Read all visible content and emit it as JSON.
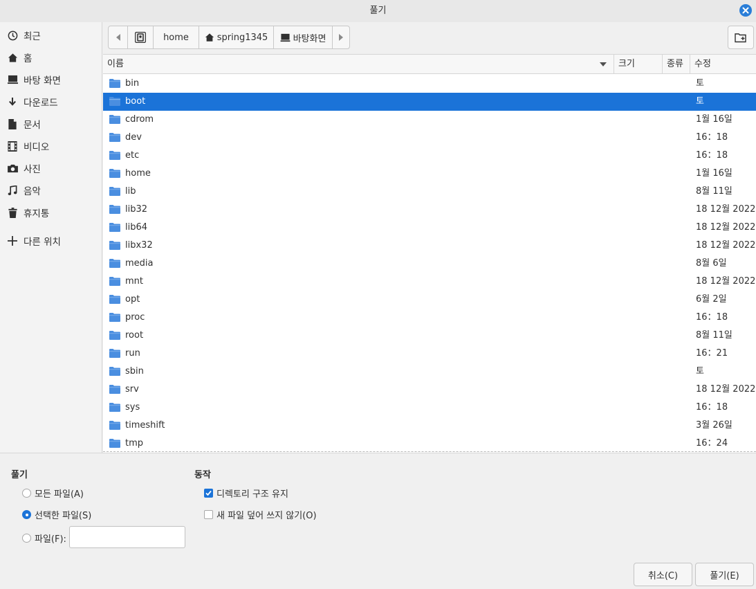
{
  "window": {
    "title": "풀기"
  },
  "sidebar": {
    "items": [
      {
        "label": "최근",
        "icon": "clock-icon"
      },
      {
        "label": "홈",
        "icon": "home-icon"
      },
      {
        "label": "바탕 화면",
        "icon": "desktop-icon"
      },
      {
        "label": "다운로드",
        "icon": "download-icon"
      },
      {
        "label": "문서",
        "icon": "document-icon"
      },
      {
        "label": "비디오",
        "icon": "video-icon"
      },
      {
        "label": "사진",
        "icon": "camera-icon"
      },
      {
        "label": "음악",
        "icon": "music-icon"
      },
      {
        "label": "휴지통",
        "icon": "trash-icon"
      },
      {
        "label": "다른 위치",
        "icon": "plus-icon"
      }
    ]
  },
  "pathbar": {
    "segments": [
      {
        "label": "",
        "icon": "drive-icon"
      },
      {
        "label": "home",
        "icon": ""
      },
      {
        "label": "spring1345",
        "icon": "home-icon"
      },
      {
        "label": "바탕화면",
        "icon": "desktop-icon"
      }
    ]
  },
  "columns": {
    "name": "이름",
    "size": "크기",
    "type": "종류",
    "modified": "수정"
  },
  "files": [
    {
      "name": "bin",
      "modified": "토",
      "selected": false
    },
    {
      "name": "boot",
      "modified": "토",
      "selected": true
    },
    {
      "name": "cdrom",
      "modified": "1월 16일",
      "selected": false
    },
    {
      "name": "dev",
      "modified": "16：18",
      "selected": false
    },
    {
      "name": "etc",
      "modified": "16：18",
      "selected": false
    },
    {
      "name": "home",
      "modified": "1월 16일",
      "selected": false
    },
    {
      "name": "lib",
      "modified": "8월 11일",
      "selected": false
    },
    {
      "name": "lib32",
      "modified": "18 12월 2022",
      "selected": false
    },
    {
      "name": "lib64",
      "modified": "18 12월 2022",
      "selected": false
    },
    {
      "name": "libx32",
      "modified": "18 12월 2022",
      "selected": false
    },
    {
      "name": "media",
      "modified": "8월 6일",
      "selected": false
    },
    {
      "name": "mnt",
      "modified": "18 12월 2022",
      "selected": false
    },
    {
      "name": "opt",
      "modified": "6월 2일",
      "selected": false
    },
    {
      "name": "proc",
      "modified": "16：18",
      "selected": false
    },
    {
      "name": "root",
      "modified": "8월 11일",
      "selected": false
    },
    {
      "name": "run",
      "modified": "16：21",
      "selected": false
    },
    {
      "name": "sbin",
      "modified": "토",
      "selected": false
    },
    {
      "name": "srv",
      "modified": "18 12월 2022",
      "selected": false
    },
    {
      "name": "sys",
      "modified": "16：18",
      "selected": false
    },
    {
      "name": "timeshift",
      "modified": "3월 26일",
      "selected": false
    },
    {
      "name": "tmp",
      "modified": "16：24",
      "selected": false
    }
  ],
  "extract": {
    "title": "풀기",
    "all_files": "모든 파일(A)",
    "selected_files": "선택한 파일(S)",
    "files_label": "파일(F):",
    "files_value": "",
    "selected_option": "selected_files"
  },
  "actions": {
    "title": "동작",
    "keep_structure": "디렉토리 구조 유지",
    "keep_structure_checked": true,
    "no_overwrite": "새 파일 덮어 쓰지 않기(O)",
    "no_overwrite_checked": false
  },
  "buttons": {
    "cancel": "취소(C)",
    "extract": "풀기(E)"
  },
  "colors": {
    "accent": "#1b73d8",
    "folder": "#4a8ee0"
  }
}
